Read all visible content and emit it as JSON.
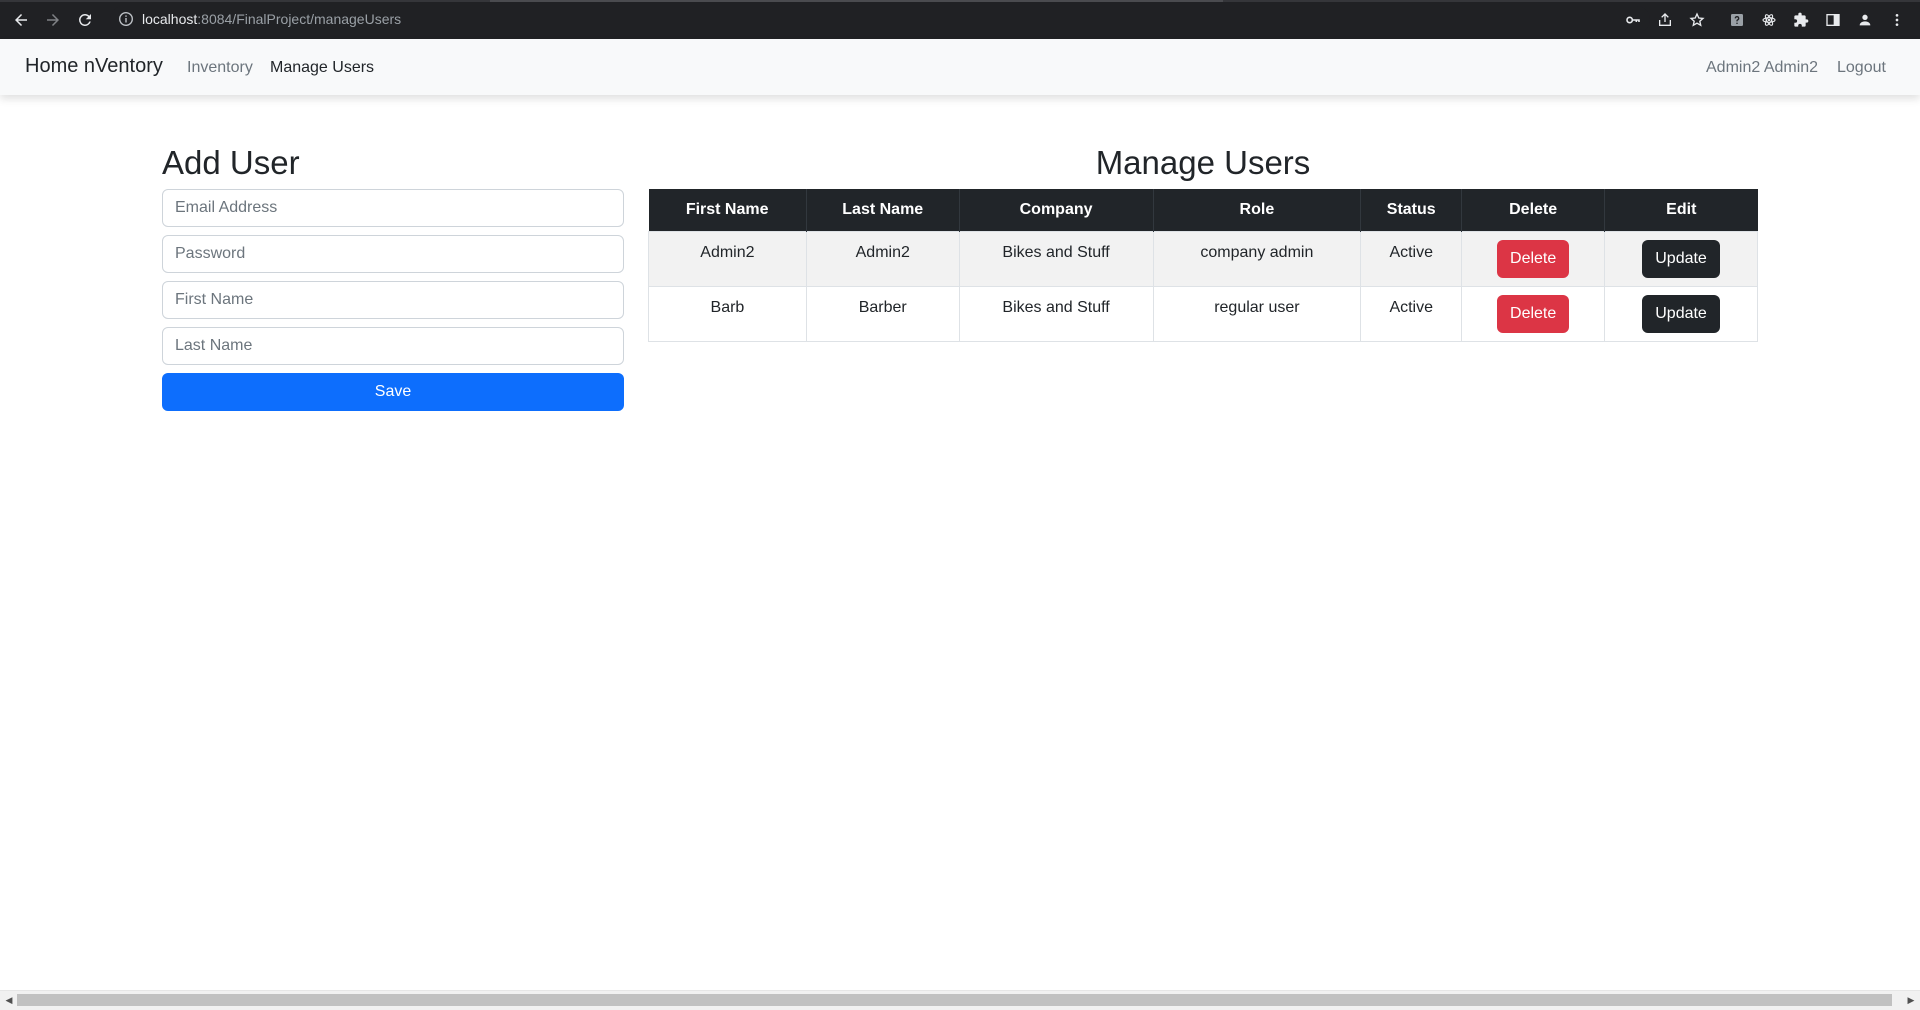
{
  "browser": {
    "url_host": "localhost",
    "url_path": ":8084/FinalProject/manageUsers",
    "icons": [
      "back-icon",
      "forward-icon",
      "reload-icon",
      "info-icon",
      "key-icon",
      "share-icon",
      "star-icon",
      "extension-question-icon",
      "extension-atom-icon",
      "puzzle-icon",
      "sidepanel-icon",
      "profile-icon",
      "menu-dots-icon"
    ]
  },
  "navbar": {
    "brand": "Home nVentory",
    "links": [
      {
        "label": "Inventory",
        "active": false
      },
      {
        "label": "Manage Users",
        "active": true
      }
    ],
    "user_name": "Admin2 Admin2",
    "logout": "Logout"
  },
  "add_user": {
    "title": "Add User",
    "email_placeholder": "Email Address",
    "password_placeholder": "Password",
    "first_name_placeholder": "First Name",
    "last_name_placeholder": "Last Name",
    "save_label": "Save"
  },
  "manage_users": {
    "title": "Manage Users",
    "columns": [
      "First Name",
      "Last Name",
      "Company",
      "Role",
      "Status",
      "Delete",
      "Edit"
    ],
    "rows": [
      {
        "first_name": "Admin2",
        "last_name": "Admin2",
        "company": "Bikes and Stuff",
        "role": "company admin",
        "status": "Active",
        "delete_label": "Delete",
        "edit_label": "Update"
      },
      {
        "first_name": "Barb",
        "last_name": "Barber",
        "company": "Bikes and Stuff",
        "role": "regular user",
        "status": "Active",
        "delete_label": "Delete",
        "edit_label": "Update"
      }
    ]
  },
  "colors": {
    "primary": "#0d6efd",
    "danger": "#dc3545",
    "dark": "#212529",
    "navbar_bg": "#f8f9fa",
    "chrome_bg": "#202124"
  }
}
